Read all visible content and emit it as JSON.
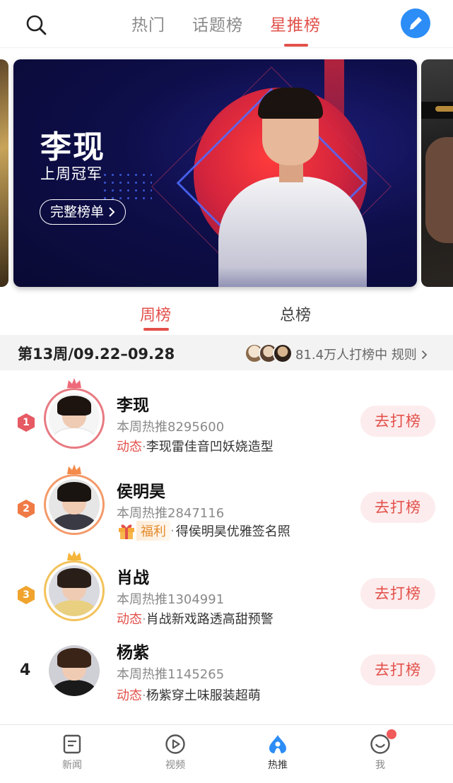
{
  "top_tabs": [
    {
      "label": "热门",
      "active": false
    },
    {
      "label": "话题榜",
      "active": false
    },
    {
      "label": "星推榜",
      "active": true
    }
  ],
  "icons": {
    "search": "search-icon",
    "edit": "pencil-icon",
    "chevron": "chevron-right-icon"
  },
  "banner": {
    "title": "李现",
    "subtitle": "上周冠军",
    "full_list_label": "完整榜单"
  },
  "sub_tabs": [
    {
      "label": "周榜",
      "active": true
    },
    {
      "label": "总榜",
      "active": false
    }
  ],
  "week": {
    "label": "第13周/09.22–09.28",
    "voters_text": "81.4万人打榜中",
    "rules_label": "规则"
  },
  "rankings": [
    {
      "rank": "1",
      "name": "李现",
      "heat": "本周热推8295600",
      "news_tag": "动态",
      "news_text": "李现雷佳音凹妖娆造型",
      "vote_label": "去打榜"
    },
    {
      "rank": "2",
      "name": "侯明昊",
      "heat": "本周热推2847116",
      "news_tag": "福利",
      "news_text": "得侯明昊优雅签名照",
      "vote_label": "去打榜"
    },
    {
      "rank": "3",
      "name": "肖战",
      "heat": "本周热推1304991",
      "news_tag": "动态",
      "news_text": "肖战新戏路透高甜预警",
      "vote_label": "去打榜"
    },
    {
      "rank": "4",
      "name": "杨紫",
      "heat": "本周热推1145265",
      "news_tag": "动态",
      "news_text": "杨紫穿土味服装超萌",
      "vote_label": "去打榜"
    }
  ],
  "colors": {
    "accent": "#e2504a",
    "gold": "#f0a42e",
    "orange": "#f07a45",
    "blue": "#2c8df6"
  },
  "bottom_nav": [
    {
      "label": "新闻",
      "icon": "news-icon",
      "active": false
    },
    {
      "label": "视频",
      "icon": "play-icon",
      "active": false
    },
    {
      "label": "热推",
      "icon": "hot-icon",
      "active": true
    },
    {
      "label": "我",
      "icon": "smile-icon",
      "active": false
    }
  ]
}
